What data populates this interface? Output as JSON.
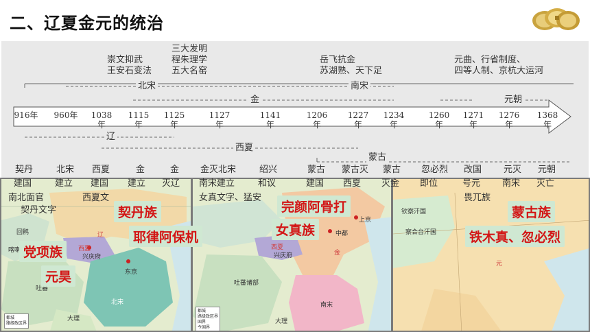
{
  "title": "二、辽夏金元的统治",
  "timeline": {
    "top_notes": [
      {
        "id": "song-note",
        "lines": [
          "崇文抑武",
          "王安石变法"
        ]
      },
      {
        "id": "invention-note",
        "lines": [
          "三大发明",
          "程朱理学",
          "五大名窑"
        ]
      },
      {
        "id": "yuefei-note",
        "lines": [
          "岳飞抗金",
          "苏湖熟、天下足"
        ]
      },
      {
        "id": "yuan-note",
        "lines": [
          "元曲、行省制度、",
          "四等人制、京杭大运河"
        ]
      }
    ],
    "dynasty_labels": {
      "north_song": "北宋",
      "south_song": "南宋",
      "jin": "金",
      "yuan": "元朝",
      "liao": "辽",
      "xixia": "西夏",
      "menggu": "蒙古"
    },
    "years": [
      "916年",
      "960年",
      "1038年",
      "1115年",
      "1125年",
      "1127年",
      "1141年",
      "1206年",
      "1227年",
      "1234年",
      "1260年",
      "1271年",
      "1276年",
      "1368年"
    ],
    "events": [
      {
        "id": "e916",
        "lines": [
          "契丹",
          "建国",
          "南北面官",
          "契丹文字"
        ]
      },
      {
        "id": "e960",
        "lines": [
          "北宋",
          "建立",
          "西夏文"
        ]
      },
      {
        "id": "e1038",
        "lines": [
          "西夏",
          "建国"
        ]
      },
      {
        "id": "e1115",
        "lines": [
          "金",
          "建立"
        ]
      },
      {
        "id": "e1125",
        "lines": [
          "金",
          "灭辽"
        ]
      },
      {
        "id": "e1127",
        "lines": [
          "金灭北宋",
          "南宋建立",
          "女真文字、猛安"
        ]
      },
      {
        "id": "e1141",
        "lines": [
          "绍兴",
          "和议"
        ]
      },
      {
        "id": "e1206",
        "lines": [
          "蒙古",
          "建国"
        ]
      },
      {
        "id": "e1227",
        "lines": [
          "蒙古灭",
          "西夏"
        ]
      },
      {
        "id": "e1234",
        "lines": [
          "蒙古",
          "灭金"
        ]
      },
      {
        "id": "e1260",
        "lines": [
          "忽必烈",
          "即位"
        ]
      },
      {
        "id": "e1271",
        "lines": [
          "改国",
          "号元"
        ]
      },
      {
        "id": "e1276",
        "lines": [
          "元灭",
          "南宋",
          "畏兀族"
        ]
      },
      {
        "id": "e1368",
        "lines": [
          "元朝",
          "灭亡"
        ]
      }
    ]
  },
  "maps": {
    "map1": {
      "callouts": [
        "契丹族",
        "耶律阿保机",
        "党项族",
        "元昊"
      ],
      "regions": [
        "辽",
        "西夏",
        "北宋",
        "兴庆府",
        "东京",
        "回鹘",
        "大理",
        "吐蕃",
        "喀喇汗"
      ]
    },
    "map2": {
      "callouts": [
        "完颜阿骨打",
        "女真族"
      ],
      "regions": [
        "金",
        "西夏",
        "南宋",
        "兴庆府",
        "中都",
        "上京",
        "吐蕃诸部",
        "大理"
      ]
    },
    "map3": {
      "callouts": [
        "蒙古族",
        "铁木真、忽必烈"
      ],
      "regions": [
        "元",
        "大都",
        "察合台汗国",
        "上都",
        "钦察汗国"
      ]
    }
  },
  "legend_items": [
    "都城",
    "路级政区界",
    "国界",
    "今国界"
  ],
  "colors": {
    "callout_text": "#d31616",
    "callout_bg": "#cfe8d2",
    "timeline_bg": "#e9e9e9",
    "liao_fill": "#f2d9a8",
    "song_fill": "#7ec5b4",
    "xixia_fill": "#b3a8d6",
    "jin_fill": "#f3c9a2",
    "nansong_fill": "#f2b6c8",
    "yuan_fill": "#f6e0b0",
    "sea": "#cfe6ec"
  }
}
